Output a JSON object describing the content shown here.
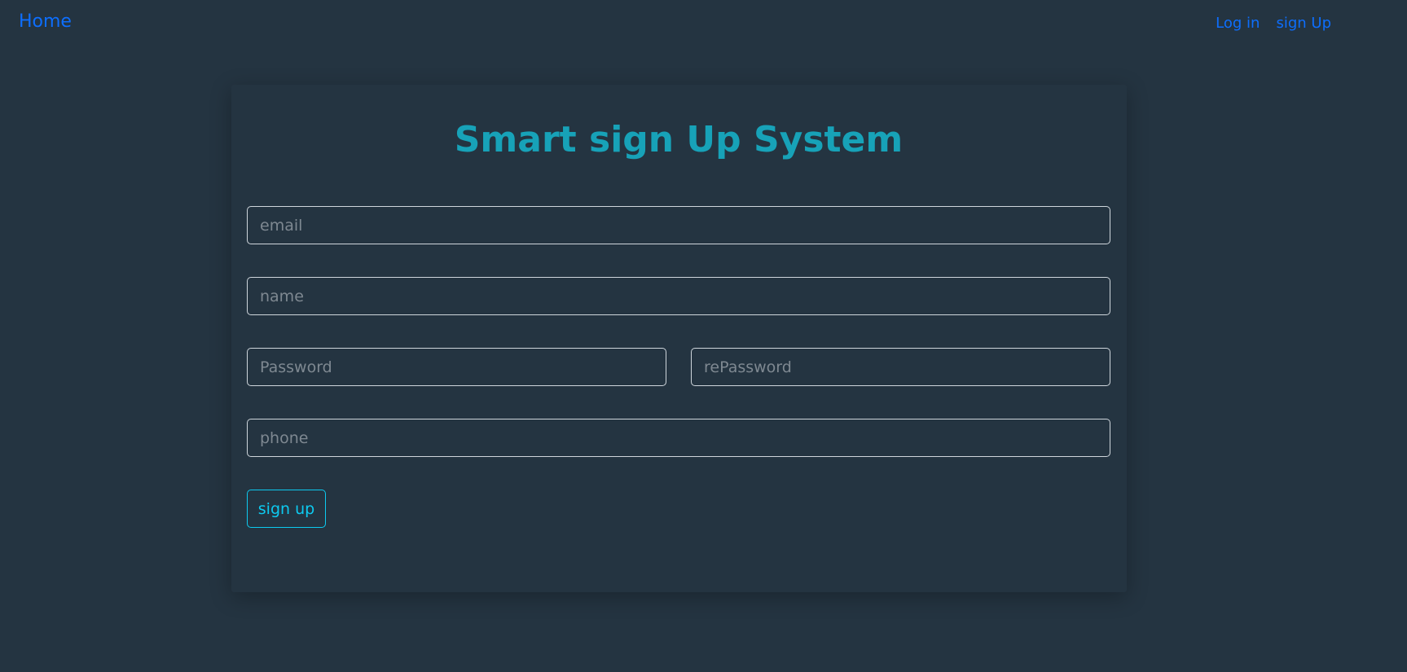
{
  "nav": {
    "home_label": "Home",
    "login_label": "Log in",
    "signup_label": "sign Up"
  },
  "form": {
    "title": "Smart sign Up System",
    "email": {
      "placeholder": "email",
      "value": ""
    },
    "name": {
      "placeholder": "name",
      "value": ""
    },
    "password": {
      "placeholder": "Password",
      "value": ""
    },
    "repassword": {
      "placeholder": "rePassword",
      "value": ""
    },
    "phone": {
      "placeholder": "phone",
      "value": ""
    },
    "submit_label": "sign up"
  },
  "colors": {
    "background": "#243441",
    "link": "#0d6efd",
    "title": "#17a2b8",
    "button": "#0dcaf0"
  }
}
